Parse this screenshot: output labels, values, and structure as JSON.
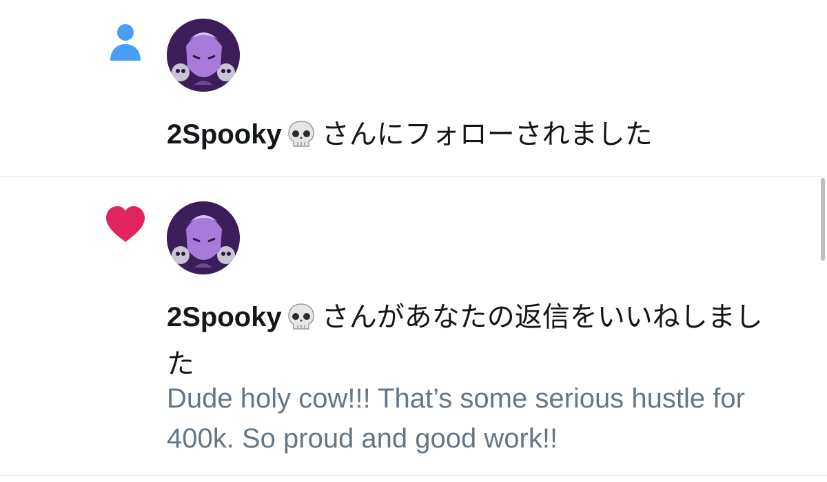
{
  "notifications": [
    {
      "type_icon": "person-icon",
      "icon_color": "#4a9ff5",
      "username": "2Spooky",
      "username_emoji": "skull-emoji",
      "action_text": "さんにフォローされました",
      "reply_preview": ""
    },
    {
      "type_icon": "heart-icon",
      "icon_color": "#e0245e",
      "username": "2Spooky",
      "username_emoji": "skull-emoji",
      "action_text": "さんがあなたの返信をいいねしました",
      "reply_preview": "Dude holy cow!!! That’s some serious hustle for 400k. So proud and good work!!"
    }
  ],
  "colors": {
    "text_primary": "#14171a",
    "text_secondary": "#657786",
    "divider": "#e1e8ed"
  }
}
